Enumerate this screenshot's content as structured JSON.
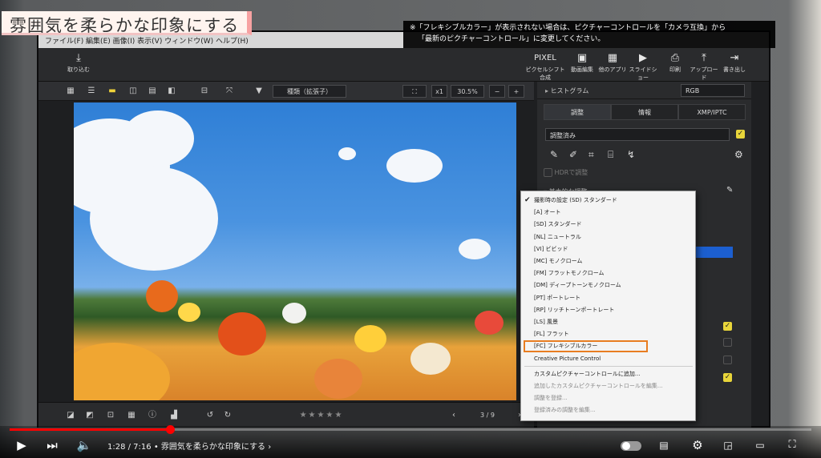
{
  "overlay": {
    "title": "雰囲気を柔らかな印象にする",
    "note_line1": "※「フレキシブルカラー」が表示されない場合は、ピクチャーコントロールを「カメラ互換」から",
    "note_line2": "「最新のピクチャーコントロール」に変更してください。"
  },
  "app": {
    "menubar_text": "ファイル(F)  編集(E)  画像(I)  表示(V)  ウィンドウ(W)  ヘルプ(H)",
    "toolbar": {
      "import_label": "取り込む",
      "pixel_shift_label": "ピクセルシフト合成",
      "movie_edit_label": "動画編集",
      "other_apps_label": "他のアプリ",
      "slideshow_label": "スライドショー",
      "print_label": "印刷",
      "upload_label": "アップロード",
      "export_label": "書き出し"
    },
    "viewbar": {
      "sort_label": "種類（拡張子）",
      "zoom_mult": "x1",
      "zoom_pct": "30.5%"
    },
    "bottombar": {
      "page_counter": "3 / 9"
    }
  },
  "right_panel": {
    "histogram_label": "ヒストグラム",
    "histogram_mode": "RGB",
    "tabs": [
      "調整",
      "情報",
      "XMP/IPTC"
    ],
    "adjust_preset": "調整済み",
    "hdr_label": "HDRで調整",
    "basic_adjust_label": "基本的な調整"
  },
  "picture_control_menu": {
    "items": [
      {
        "label": "撮影時の設定 (SD) スタンダード",
        "checked": true,
        "dim": false
      },
      {
        "label": "[A] オート",
        "checked": false,
        "dim": false
      },
      {
        "label": "[SD] スタンダード",
        "checked": false,
        "dim": false
      },
      {
        "label": "[NL] ニュートラル",
        "checked": false,
        "dim": false
      },
      {
        "label": "[VI] ビビッド",
        "checked": false,
        "dim": false
      },
      {
        "label": "[MC] モノクローム",
        "checked": false,
        "dim": false
      },
      {
        "label": "[FM] フラットモノクローム",
        "checked": false,
        "dim": false
      },
      {
        "label": "[DM] ディープトーンモノクローム",
        "checked": false,
        "dim": false
      },
      {
        "label": "[PT] ポートレート",
        "checked": false,
        "dim": false
      },
      {
        "label": "[RP] リッチトーンポートレート",
        "checked": false,
        "dim": false
      },
      {
        "label": "[LS] 風景",
        "checked": false,
        "dim": false
      },
      {
        "label": "[FL] フラット",
        "checked": false,
        "dim": false
      },
      {
        "label": "[FC] フレキシブルカラー",
        "checked": false,
        "dim": false
      },
      {
        "label": "Creative Picture Control",
        "checked": false,
        "dim": false
      },
      {
        "label": "カスタムピクチャーコントロールに追加...",
        "checked": false,
        "dim": false
      },
      {
        "label": "追加したカスタムピクチャーコントロールを編集...",
        "checked": false,
        "dim": true
      },
      {
        "label": "調整を登録...",
        "checked": false,
        "dim": true
      },
      {
        "label": "登録済みの調整を編集...",
        "checked": false,
        "dim": true
      }
    ],
    "highlighted_index": 12
  },
  "player": {
    "time_text": "1:28 / 7:16",
    "chapter_text": "• 雰囲気を柔らかな印象にする",
    "progress_fraction": 0.2,
    "accent_color": "#ff0000"
  }
}
